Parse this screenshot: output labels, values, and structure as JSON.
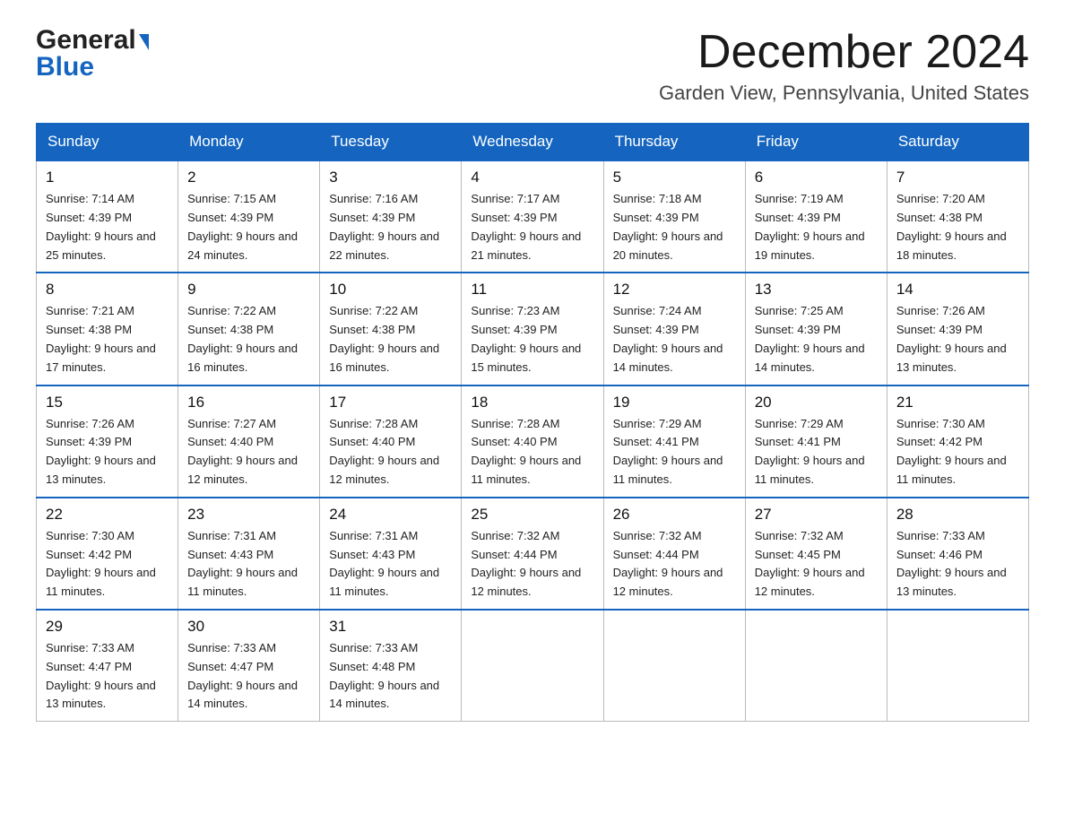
{
  "header": {
    "logo_general": "General",
    "logo_blue": "Blue",
    "month_title": "December 2024",
    "location": "Garden View, Pennsylvania, United States"
  },
  "calendar": {
    "days_of_week": [
      "Sunday",
      "Monday",
      "Tuesday",
      "Wednesday",
      "Thursday",
      "Friday",
      "Saturday"
    ],
    "weeks": [
      [
        {
          "day": "1",
          "sunrise": "7:14 AM",
          "sunset": "4:39 PM",
          "daylight": "9 hours and 25 minutes."
        },
        {
          "day": "2",
          "sunrise": "7:15 AM",
          "sunset": "4:39 PM",
          "daylight": "9 hours and 24 minutes."
        },
        {
          "day": "3",
          "sunrise": "7:16 AM",
          "sunset": "4:39 PM",
          "daylight": "9 hours and 22 minutes."
        },
        {
          "day": "4",
          "sunrise": "7:17 AM",
          "sunset": "4:39 PM",
          "daylight": "9 hours and 21 minutes."
        },
        {
          "day": "5",
          "sunrise": "7:18 AM",
          "sunset": "4:39 PM",
          "daylight": "9 hours and 20 minutes."
        },
        {
          "day": "6",
          "sunrise": "7:19 AM",
          "sunset": "4:39 PM",
          "daylight": "9 hours and 19 minutes."
        },
        {
          "day": "7",
          "sunrise": "7:20 AM",
          "sunset": "4:38 PM",
          "daylight": "9 hours and 18 minutes."
        }
      ],
      [
        {
          "day": "8",
          "sunrise": "7:21 AM",
          "sunset": "4:38 PM",
          "daylight": "9 hours and 17 minutes."
        },
        {
          "day": "9",
          "sunrise": "7:22 AM",
          "sunset": "4:38 PM",
          "daylight": "9 hours and 16 minutes."
        },
        {
          "day": "10",
          "sunrise": "7:22 AM",
          "sunset": "4:38 PM",
          "daylight": "9 hours and 16 minutes."
        },
        {
          "day": "11",
          "sunrise": "7:23 AM",
          "sunset": "4:39 PM",
          "daylight": "9 hours and 15 minutes."
        },
        {
          "day": "12",
          "sunrise": "7:24 AM",
          "sunset": "4:39 PM",
          "daylight": "9 hours and 14 minutes."
        },
        {
          "day": "13",
          "sunrise": "7:25 AM",
          "sunset": "4:39 PM",
          "daylight": "9 hours and 14 minutes."
        },
        {
          "day": "14",
          "sunrise": "7:26 AM",
          "sunset": "4:39 PM",
          "daylight": "9 hours and 13 minutes."
        }
      ],
      [
        {
          "day": "15",
          "sunrise": "7:26 AM",
          "sunset": "4:39 PM",
          "daylight": "9 hours and 13 minutes."
        },
        {
          "day": "16",
          "sunrise": "7:27 AM",
          "sunset": "4:40 PM",
          "daylight": "9 hours and 12 minutes."
        },
        {
          "day": "17",
          "sunrise": "7:28 AM",
          "sunset": "4:40 PM",
          "daylight": "9 hours and 12 minutes."
        },
        {
          "day": "18",
          "sunrise": "7:28 AM",
          "sunset": "4:40 PM",
          "daylight": "9 hours and 11 minutes."
        },
        {
          "day": "19",
          "sunrise": "7:29 AM",
          "sunset": "4:41 PM",
          "daylight": "9 hours and 11 minutes."
        },
        {
          "day": "20",
          "sunrise": "7:29 AM",
          "sunset": "4:41 PM",
          "daylight": "9 hours and 11 minutes."
        },
        {
          "day": "21",
          "sunrise": "7:30 AM",
          "sunset": "4:42 PM",
          "daylight": "9 hours and 11 minutes."
        }
      ],
      [
        {
          "day": "22",
          "sunrise": "7:30 AM",
          "sunset": "4:42 PM",
          "daylight": "9 hours and 11 minutes."
        },
        {
          "day": "23",
          "sunrise": "7:31 AM",
          "sunset": "4:43 PM",
          "daylight": "9 hours and 11 minutes."
        },
        {
          "day": "24",
          "sunrise": "7:31 AM",
          "sunset": "4:43 PM",
          "daylight": "9 hours and 11 minutes."
        },
        {
          "day": "25",
          "sunrise": "7:32 AM",
          "sunset": "4:44 PM",
          "daylight": "9 hours and 12 minutes."
        },
        {
          "day": "26",
          "sunrise": "7:32 AM",
          "sunset": "4:44 PM",
          "daylight": "9 hours and 12 minutes."
        },
        {
          "day": "27",
          "sunrise": "7:32 AM",
          "sunset": "4:45 PM",
          "daylight": "9 hours and 12 minutes."
        },
        {
          "day": "28",
          "sunrise": "7:33 AM",
          "sunset": "4:46 PM",
          "daylight": "9 hours and 13 minutes."
        }
      ],
      [
        {
          "day": "29",
          "sunrise": "7:33 AM",
          "sunset": "4:47 PM",
          "daylight": "9 hours and 13 minutes."
        },
        {
          "day": "30",
          "sunrise": "7:33 AM",
          "sunset": "4:47 PM",
          "daylight": "9 hours and 14 minutes."
        },
        {
          "day": "31",
          "sunrise": "7:33 AM",
          "sunset": "4:48 PM",
          "daylight": "9 hours and 14 minutes."
        },
        null,
        null,
        null,
        null
      ]
    ]
  },
  "labels": {
    "sunrise_prefix": "Sunrise: ",
    "sunset_prefix": "Sunset: ",
    "daylight_prefix": "Daylight: "
  },
  "colors": {
    "header_bg": "#1565c0",
    "accent_blue": "#1565c0"
  }
}
